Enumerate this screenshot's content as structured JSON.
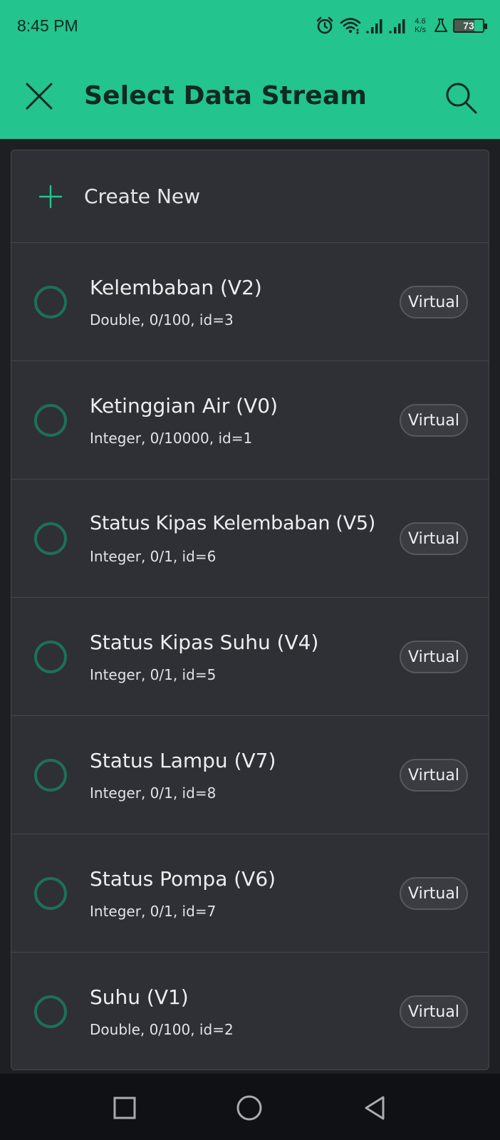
{
  "status_bar": {
    "time": "8:45 PM",
    "speed_value": "4.6",
    "speed_unit": "K/s",
    "battery": "73",
    "icons": [
      "alarm-icon",
      "wifi-icon",
      "signal-icon",
      "signal-icon",
      "flask-icon",
      "battery-icon"
    ]
  },
  "header": {
    "title": "Select Data Stream",
    "close_icon": "close-icon",
    "search_icon": "search-icon"
  },
  "create": {
    "label": "Create New",
    "icon": "plus-icon"
  },
  "streams": [
    {
      "name": "Kelembaban (V2)",
      "meta": "Double, 0/100, id=3",
      "badge": "Virtual"
    },
    {
      "name": "Ketinggian Air (V0)",
      "meta": "Integer, 0/10000, id=1",
      "badge": "Virtual"
    },
    {
      "name": "Status Kipas Kelembaban (V5)",
      "meta": "Integer, 0/1, id=6",
      "badge": "Virtual"
    },
    {
      "name": "Status Kipas Suhu (V4)",
      "meta": "Integer, 0/1, id=5",
      "badge": "Virtual"
    },
    {
      "name": "Status Lampu (V7)",
      "meta": "Integer, 0/1, id=8",
      "badge": "Virtual"
    },
    {
      "name": "Status Pompa (V6)",
      "meta": "Integer, 0/1, id=7",
      "badge": "Virtual"
    },
    {
      "name": "Suhu (V1)",
      "meta": "Double, 0/100, id=2",
      "badge": "Virtual"
    }
  ],
  "navbar": {
    "icons": [
      "recent-apps-icon",
      "home-icon",
      "back-icon"
    ]
  },
  "colors": {
    "accent": "#23c48e",
    "card": "#2e3035",
    "radio_border": "#1f6f57",
    "background": "#1e1f23"
  }
}
